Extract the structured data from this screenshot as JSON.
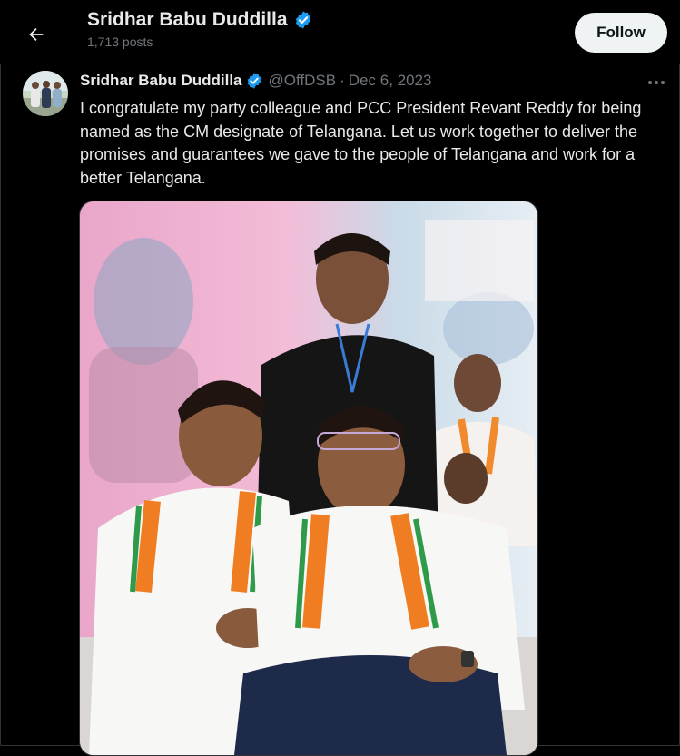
{
  "header": {
    "title": "Sridhar Babu Duddilla",
    "posts": "1,713 posts",
    "follow_label": "Follow"
  },
  "tweet": {
    "author_name": "Sridhar Babu Duddilla",
    "handle": "@OffDSB",
    "separator": "·",
    "date": "Dec 6, 2023",
    "text": "I congratulate my party colleague and PCC President Revant Reddy for being named as the CM designate of Telangana. Let us work together to deliver the promises and guarantees we gave to the people of Telangana and work for a better Telangana."
  },
  "icons": {
    "back": "arrow-left-icon",
    "verified": "verified-badge-icon",
    "more": "more-horizontal-icon"
  },
  "colors": {
    "background": "#000000",
    "text": "#e7e9ea",
    "muted": "#71767b",
    "verified": "#1d9bf0",
    "follow_bg": "#eff3f4"
  }
}
